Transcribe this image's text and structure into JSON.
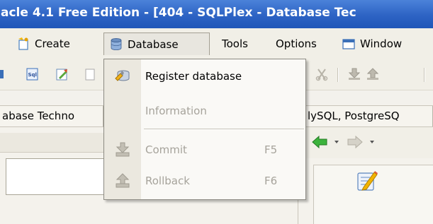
{
  "window": {
    "title": "acle 4.1 Free Edition - [404 - SQLPlex - Database Tec"
  },
  "menubar": {
    "items": [
      {
        "label": "Create",
        "icon": "create-icon"
      },
      {
        "label": "Database",
        "icon": "database-icon",
        "open": true
      },
      {
        "label": "Tools"
      },
      {
        "label": "Options"
      },
      {
        "label": "Window",
        "icon": "window-icon"
      }
    ]
  },
  "toolbar": {
    "icons": [
      "sql-editor-icon",
      "sql-icon",
      "edit-sql-icon",
      "cut-icon",
      "commit-icon",
      "rollback-icon"
    ]
  },
  "tabs": {
    "left": "abase Techno",
    "right": "lySQL, PostgreSQ"
  },
  "database_menu": {
    "items": [
      {
        "label": "Register database",
        "icon": "register-database-icon",
        "enabled": true
      },
      {
        "label": "Information",
        "enabled": false
      },
      {
        "label": "Commit",
        "shortcut": "F5",
        "icon": "commit-icon",
        "enabled": false
      },
      {
        "label": "Rollback",
        "shortcut": "F6",
        "icon": "rollback-icon",
        "enabled": false
      }
    ]
  },
  "colors": {
    "titlebar": "#2d63c4",
    "menu_background": "#f1efe7",
    "disabled_text": "#a6a39b",
    "back_arrow": "#3cb33c"
  }
}
